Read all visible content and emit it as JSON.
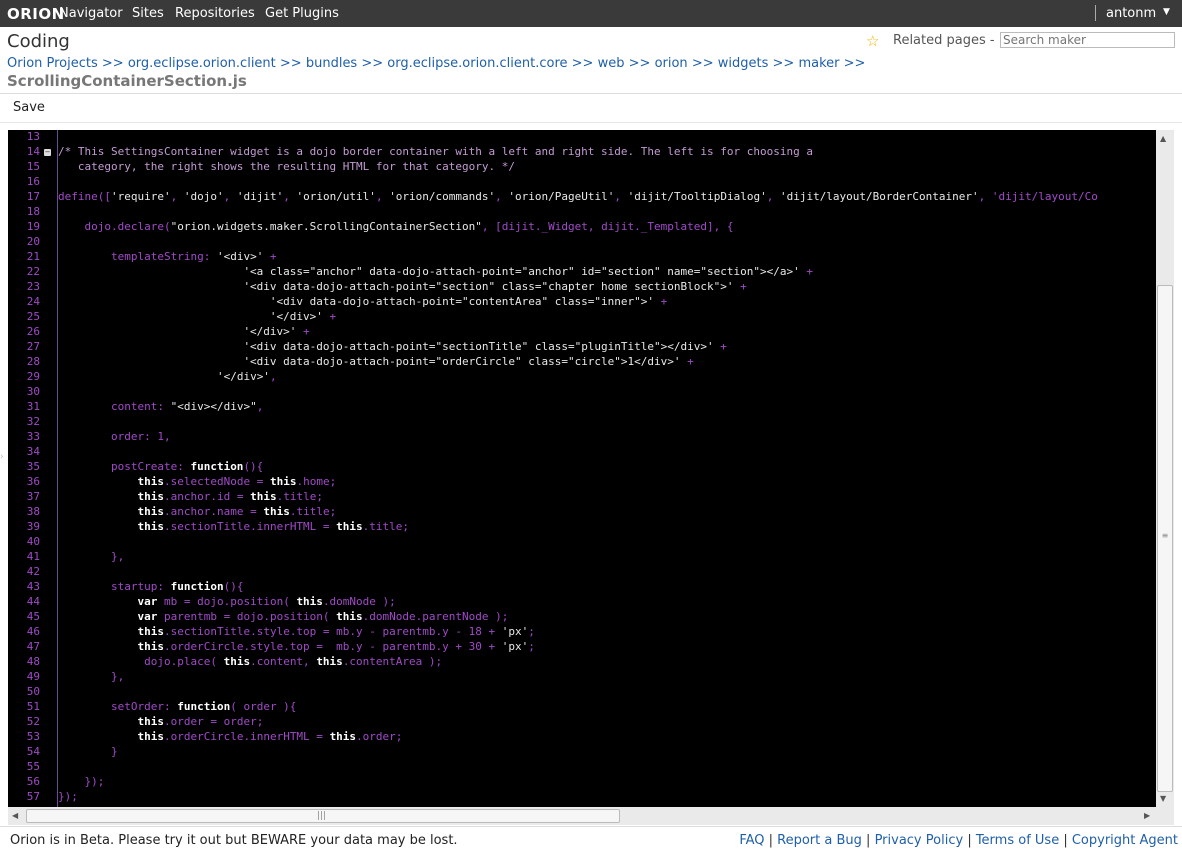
{
  "app": {
    "logo": "ORION",
    "nav": [
      "Navigator",
      "Sites",
      "Repositories",
      "Get Plugins"
    ],
    "user": "antonm"
  },
  "header": {
    "title": "Coding",
    "related_pages": "Related pages -",
    "search_placeholder": "Search maker",
    "breadcrumb": [
      "Orion Projects",
      "org.eclipse.orion.client",
      "bundles",
      "org.eclipse.orion.client.core",
      "web",
      "orion",
      "widgets",
      "maker"
    ],
    "breadcrumb_sep": ">>",
    "file": "ScrollingContainerSection.js"
  },
  "toolbar": {
    "save_label": "Save"
  },
  "editor": {
    "line_numbers": [
      "13",
      "14",
      "15",
      "16",
      "17",
      "18",
      "19",
      "20",
      "21",
      "22",
      "23",
      "24",
      "25",
      "26",
      "27",
      "28",
      "29",
      "30",
      "31",
      "32",
      "33",
      "34",
      "35",
      "36",
      "37",
      "38",
      "39",
      "40",
      "41",
      "42",
      "43",
      "44",
      "45",
      "46",
      "47",
      "48",
      "49",
      "50",
      "51",
      "52",
      "53",
      "54",
      "55",
      "56",
      "57"
    ],
    "fold_marker_line": "14",
    "lines": [
      "",
      "/* This SettingsContainer widget is a dojo border container with a left and right side. The left is for choosing a",
      "   category, the right shows the resulting HTML for that category. */",
      "",
      "define(['require', 'dojo', 'dijit', 'orion/util', 'orion/commands', 'orion/PageUtil', 'dijit/TooltipDialog', 'dijit/layout/BorderContainer', 'dijit/layout/Co",
      "",
      "    dojo.declare(\"orion.widgets.maker.ScrollingContainerSection\", [dijit._Widget, dijit._Templated], {",
      "",
      "        templateString: '<div>' +",
      "                            '<a class=\"anchor\" data-dojo-attach-point=\"anchor\" id=\"section\" name=\"section\"></a>' +",
      "                            '<div data-dojo-attach-point=\"section\" class=\"chapter home sectionBlock\">' +",
      "                                '<div data-dojo-attach-point=\"contentArea\" class=\"inner\">' +",
      "                                '</div>' +",
      "                            '</div>' +",
      "                            '<div data-dojo-attach-point=\"sectionTitle\" class=\"pluginTitle\"></div>' +",
      "                            '<div data-dojo-attach-point=\"orderCircle\" class=\"circle\">1</div>' +",
      "                        '</div>',",
      "",
      "        content: \"<div></div>\",",
      "",
      "        order: 1,",
      "",
      "        postCreate: function(){",
      "            this.selectedNode = this.home;",
      "            this.anchor.id = this.title;",
      "            this.anchor.name = this.title;",
      "            this.sectionTitle.innerHTML = this.title;",
      "",
      "        },",
      "",
      "        startup: function(){",
      "            var mb = dojo.position( this.domNode );",
      "            var parentmb = dojo.position( this.domNode.parentNode );",
      "            this.sectionTitle.style.top = mb.y - parentmb.y - 18 + 'px';",
      "            this.orderCircle.style.top =  mb.y - parentmb.y + 30 + 'px';",
      "             dojo.place( this.content, this.contentArea );",
      "        },",
      "",
      "        setOrder: function( order ){",
      "            this.order = order;",
      "            this.orderCircle.innerHTML = this.order;",
      "        }",
      "",
      "    });",
      "});"
    ]
  },
  "footer": {
    "beta_notice": "Orion is in Beta. Please try it out but BEWARE your data may be lost.",
    "links": [
      "FAQ",
      "Report a Bug",
      "Privacy Policy",
      "Terms of Use",
      "Copyright Agent"
    ]
  },
  "colors": {
    "topbar": "#3a3a3a",
    "editor_bg": "#000000",
    "code_default": "#a04ac8",
    "comment": "#c39bd3",
    "string": "#e8e8e8",
    "keyword": "#ffffff",
    "link": "#1f5fa8"
  }
}
